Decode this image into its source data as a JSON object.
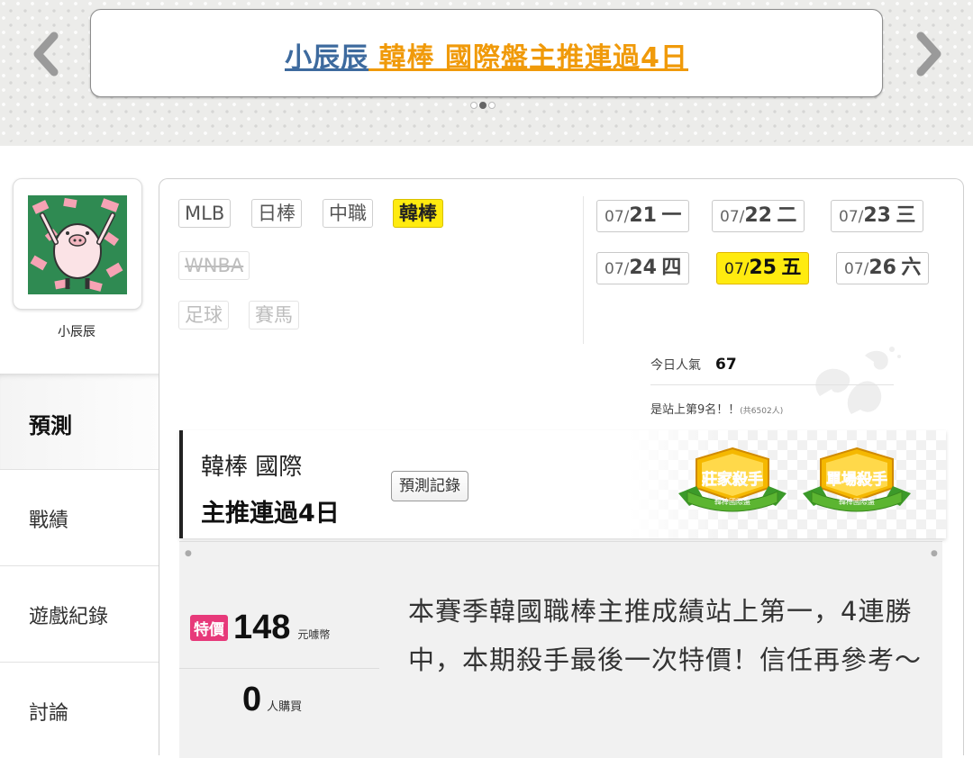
{
  "banner": {
    "name": "小辰辰",
    "rest": " 韓棒 國際盤主推連過4日",
    "dots": 3,
    "active_dot": 2
  },
  "user": {
    "name": "小辰辰"
  },
  "sidebar": {
    "items": [
      {
        "label": "預測",
        "active": true
      },
      {
        "label": "戰績",
        "active": false
      },
      {
        "label": "遊戲紀錄",
        "active": false
      },
      {
        "label": "討論",
        "active": false
      }
    ]
  },
  "leagues": [
    {
      "label": "MLB",
      "state": "normal"
    },
    {
      "label": "日棒",
      "state": "normal"
    },
    {
      "label": "中職",
      "state": "normal"
    },
    {
      "label": "韓棒",
      "state": "active"
    },
    {
      "label": "WNBA",
      "state": "disabled"
    },
    {
      "label": "足球",
      "state": "disabled"
    },
    {
      "label": "賽馬",
      "state": "disabled"
    }
  ],
  "dates": [
    {
      "month": "07/",
      "day": "21",
      "weekday": "一",
      "active": false
    },
    {
      "month": "07/",
      "day": "22",
      "weekday": "二",
      "active": false
    },
    {
      "month": "07/",
      "day": "23",
      "weekday": "三",
      "active": false
    },
    {
      "month": "07/",
      "day": "24",
      "weekday": "四",
      "active": false
    },
    {
      "month": "07/",
      "day": "25",
      "weekday": "五",
      "active": true
    },
    {
      "month": "07/",
      "day": "26",
      "weekday": "六",
      "active": false
    }
  ],
  "popularity": {
    "label": "今日人氣",
    "value": "67",
    "rank_text": "是站上第9名！！",
    "total_text": "(共6502人)"
  },
  "prediction": {
    "title_line1": "韓棒 國際",
    "title_line2": "主推連過4日",
    "history_button": "預測記錄",
    "badges": [
      {
        "title": "莊家殺手",
        "subtitle": "韓棒國際盤"
      },
      {
        "title": "單場殺手",
        "subtitle": "韓棒國際盤"
      }
    ]
  },
  "product": {
    "special_tag": "特價",
    "price": "148",
    "price_unit": "元噱幣",
    "buyers": "0",
    "buyers_unit": "人購買",
    "description": "本賽季韓國職棒主推成績站上第一，4連勝中，本期殺手最後一次特價！信任再參考～"
  },
  "colors": {
    "accent_yellow": "#ffeb0f",
    "banner_name": "#3d6a9e",
    "banner_rest": "#f09a0a",
    "special_tag": "#e7397a",
    "badge_green": "#5cb531"
  }
}
